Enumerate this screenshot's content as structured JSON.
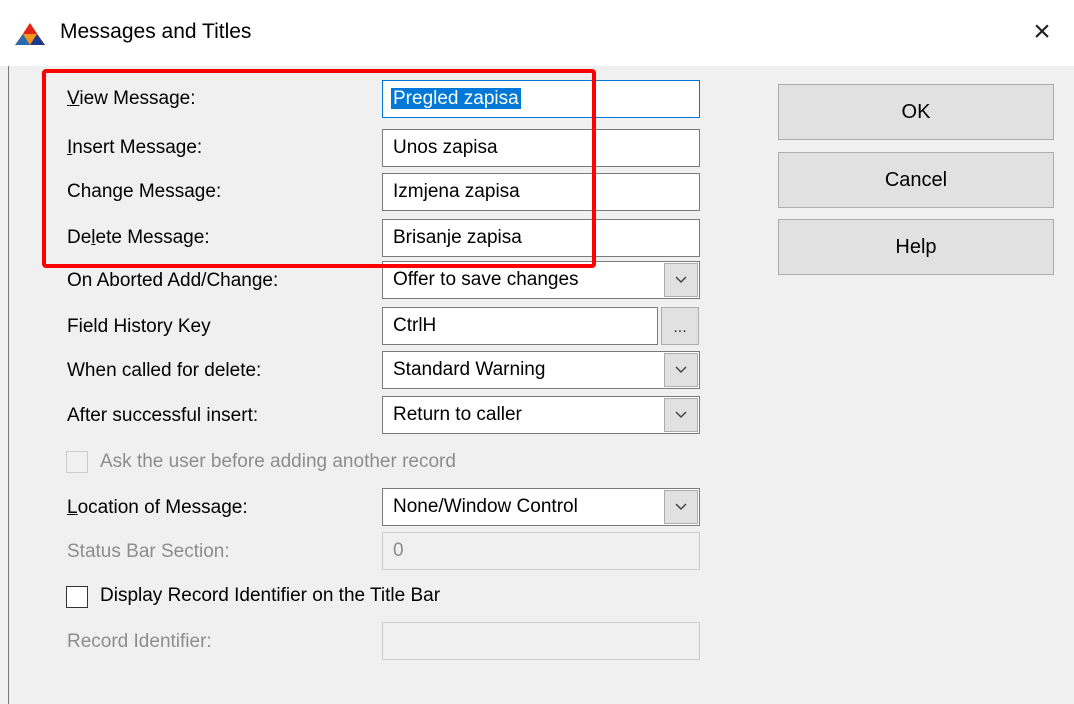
{
  "window": {
    "title": "Messages and Titles",
    "close_glyph": "×",
    "app_icon": "app-logo-icon"
  },
  "messages": {
    "view_label_u": "V",
    "view_label_rest": "iew Message:",
    "view_value": "Pregled zapisa",
    "insert_label_u": "I",
    "insert_label_rest": "nsert Message:",
    "insert_value": "Unos zapisa",
    "change_label_pre": "Chan",
    "change_label_u": "g",
    "change_label_rest": "e Message:",
    "change_value": "Izmjena zapisa",
    "delete_label_pre": "De",
    "delete_label_u": "l",
    "delete_label_rest": "ete Message:",
    "delete_value": "Brisanje zapisa"
  },
  "options": {
    "aborted_label": "On Aborted Add/Change:",
    "aborted_value": "Offer to save changes",
    "history_label": "Field History Key",
    "history_value": "CtrlH",
    "history_button": "...",
    "delete_call_label": "When called for delete:",
    "delete_call_value": "Standard Warning",
    "after_insert_label": "After successful insert:",
    "after_insert_value": "Return to caller",
    "ask_user_label": "Ask the user before adding another record",
    "location_label_u": "L",
    "location_label_rest": "ocation of Message:",
    "location_value": "None/Window Control",
    "status_section_label": "Status Bar Section:",
    "status_section_value": "0",
    "display_identifier_label": "Display Record Identifier on the Title Bar",
    "record_identifier_label": "Record Identifier:",
    "record_identifier_value": ""
  },
  "buttons": {
    "ok": "OK",
    "cancel": "Cancel",
    "help": "Help"
  },
  "colors": {
    "highlight": "#ff0000",
    "selection": "#0078d7"
  }
}
